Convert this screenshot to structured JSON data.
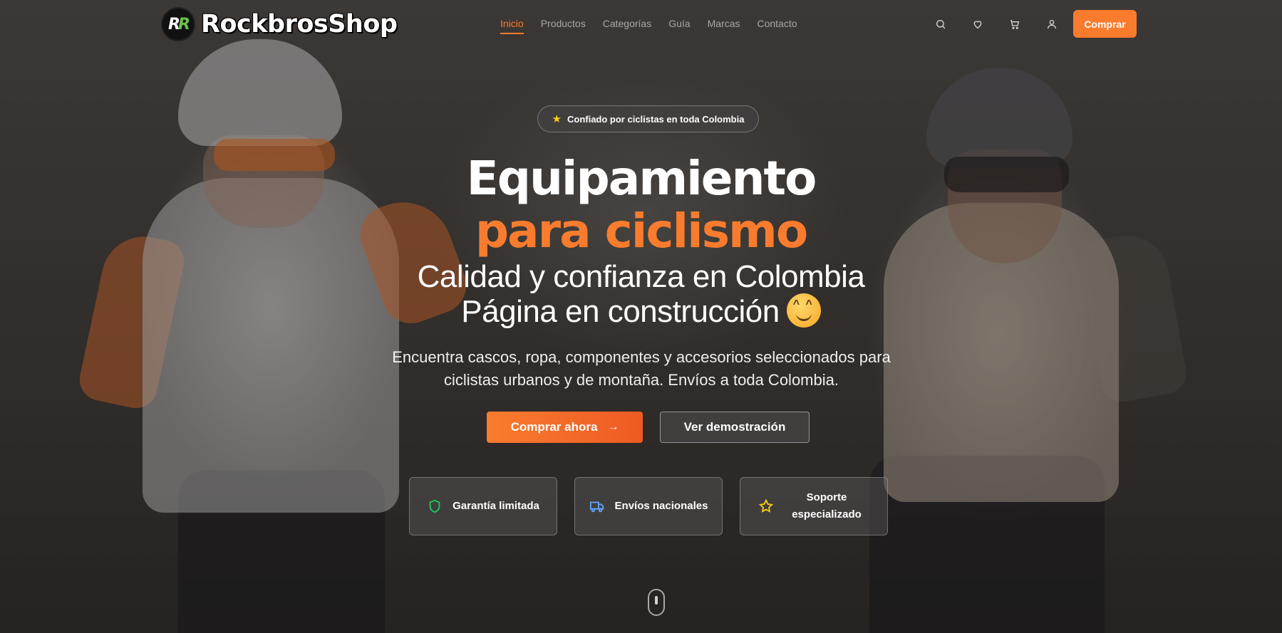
{
  "brand": {
    "logo_text": "RockbrosShop",
    "logo_mark": "R"
  },
  "nav": {
    "links": [
      "Inicio",
      "Productos",
      "Categorías",
      "Guía",
      "Marcas",
      "Contacto"
    ],
    "active": "Inicio",
    "icons": [
      "search-icon",
      "heart-icon",
      "cart-icon",
      "user-icon"
    ],
    "buy_label": "Comprar"
  },
  "hero": {
    "badge": "Confiado por ciclistas en toda Colombia",
    "title_line1": "Equipamiento",
    "title_line2": "para ciclismo",
    "subtitle_line1": "Calidad y confianza en Colombia",
    "subtitle_line2": "Página en construcción",
    "emoji": "smiling-face-emoji",
    "description": "Encuentra cascos, ropa, componentes y accesorios seleccionados para ciclistas urbanos y de montaña. Envíos a toda Colombia.",
    "cta_primary": "Comprar ahora",
    "cta_secondary": "Ver demostración"
  },
  "features": [
    {
      "label": "Garantía limitada",
      "icon": "shield-icon",
      "color": "#22c55e"
    },
    {
      "label": "Envíos nacionales",
      "icon": "truck-icon",
      "color": "#60a5fa"
    },
    {
      "label": "Soporte especializado",
      "icon": "star-icon",
      "color": "#facc15"
    }
  ],
  "colors": {
    "accent": "#f97c2e",
    "accent_dark": "#ee5a24"
  }
}
